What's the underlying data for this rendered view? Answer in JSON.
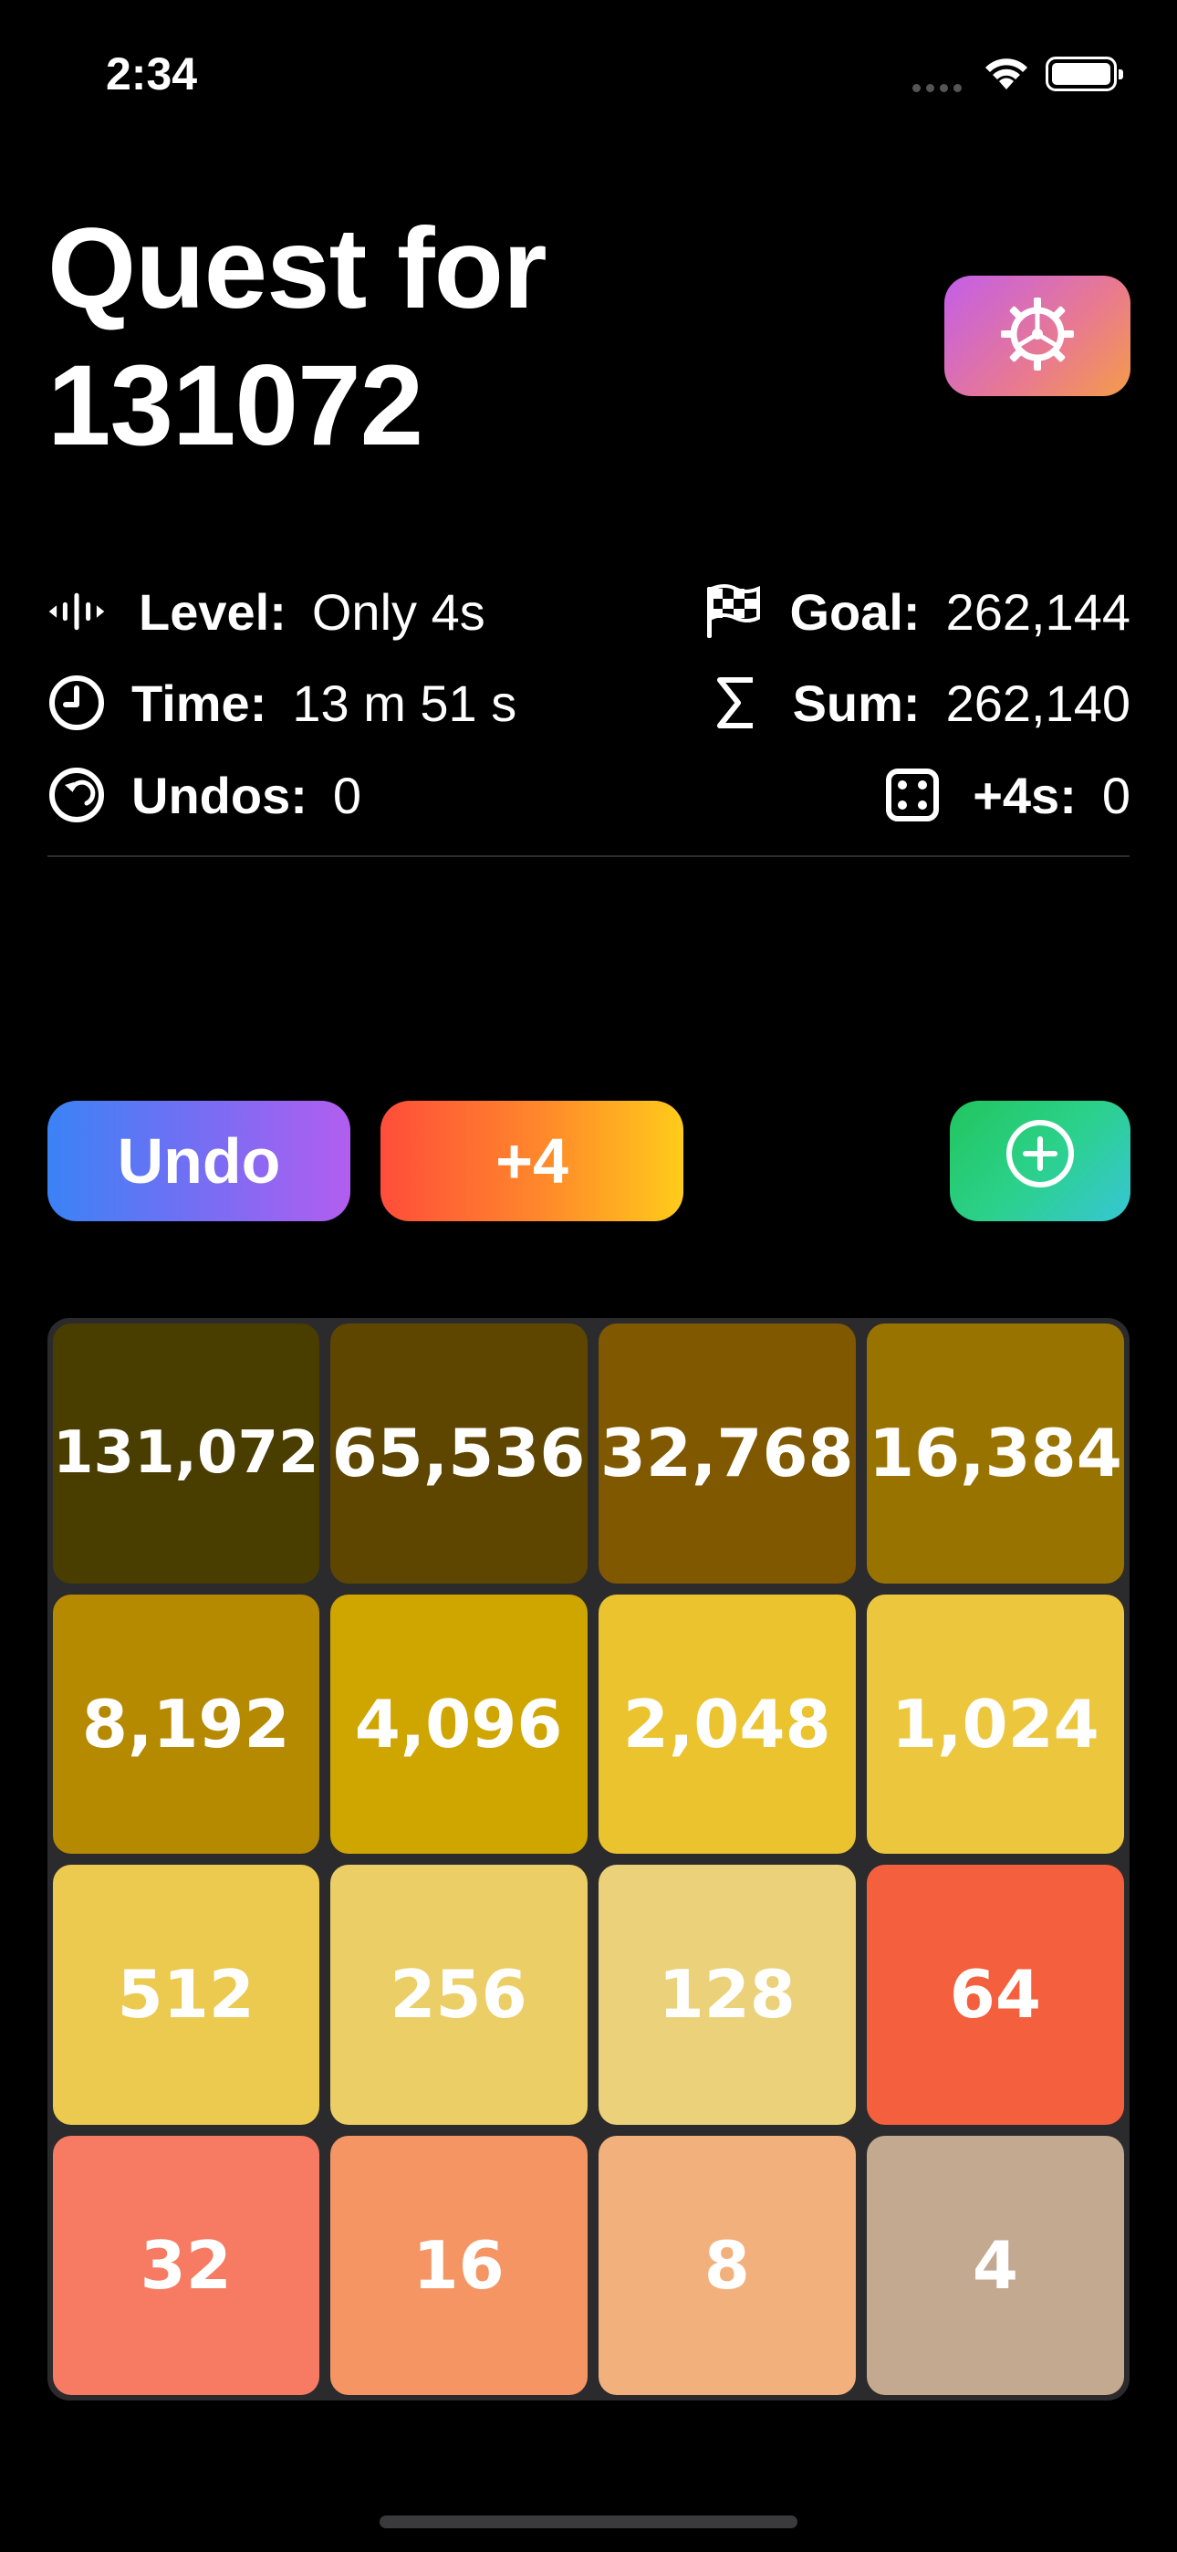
{
  "status_bar": {
    "time": "2:34"
  },
  "header": {
    "title": "Quest for 131072",
    "settings_icon": "gear-icon",
    "accent_gradient": [
      "#c35ee9",
      "#f49c4a"
    ]
  },
  "stats": {
    "level": {
      "label": "Level:",
      "value": "Only 4s",
      "icon": "level-icon"
    },
    "time": {
      "label": "Time:",
      "value": "13 m 51 s",
      "icon": "clock-icon"
    },
    "undos": {
      "label": "Undos:",
      "value": "0",
      "icon": "undo-icon"
    },
    "goal": {
      "label": "Goal:",
      "value": "262,144",
      "icon": "checkered-flag-icon"
    },
    "sum": {
      "label": "Sum:",
      "value": "262,140",
      "icon": "sigma-icon"
    },
    "plus4s": {
      "label": "+4s:",
      "value": "0",
      "icon": "dice-icon"
    }
  },
  "actions": {
    "undo_label": "Undo",
    "plus4_label": "+4",
    "new_icon": "plus-circle-icon"
  },
  "board": {
    "tiles": [
      {
        "value": "131,072",
        "color": "#4a3d00"
      },
      {
        "value": "65,536",
        "color": "#5e4600"
      },
      {
        "value": "32,768",
        "color": "#7f5800"
      },
      {
        "value": "16,384",
        "color": "#997300"
      },
      {
        "value": "8,192",
        "color": "#b58a00"
      },
      {
        "value": "4,096",
        "color": "#cfa500"
      },
      {
        "value": "2,048",
        "color": "#eac32e"
      },
      {
        "value": "1,024",
        "color": "#ecc73e"
      },
      {
        "value": "512",
        "color": "#ebca4f"
      },
      {
        "value": "256",
        "color": "#ebce66"
      },
      {
        "value": "128",
        "color": "#ebd27a"
      },
      {
        "value": "64",
        "color": "#f4603d"
      },
      {
        "value": "32",
        "color": "#f67b62"
      },
      {
        "value": "16",
        "color": "#f49563"
      },
      {
        "value": "8",
        "color": "#f2b17c"
      },
      {
        "value": "4",
        "color": "#c3a98f"
      }
    ]
  }
}
